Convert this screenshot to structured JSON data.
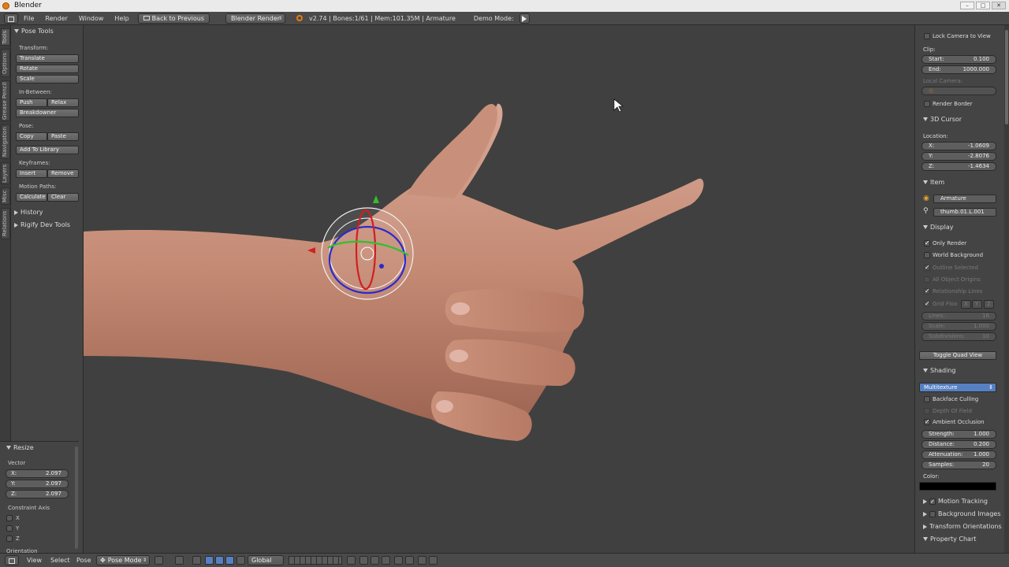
{
  "window": {
    "title": "Blender"
  },
  "menubar": {
    "items": [
      "File",
      "Render",
      "Window",
      "Help"
    ],
    "back_label": "Back to Previous",
    "engine": "Blender Render",
    "status": "v2.74 | Bones:1/61 | Mem:101.35M | Armature",
    "mode_label": "Demo Mode:"
  },
  "tabs": [
    "Tools",
    "Options",
    "Grease Pencil",
    "Navigation",
    "Layers",
    "Misc",
    "Relations"
  ],
  "tool_panel": {
    "title": "Pose Tools",
    "transform_label": "Transform:",
    "translate": "Translate",
    "rotate": "Rotate",
    "scale": "Scale",
    "inbetween_label": "In-Between:",
    "push": "Push",
    "relax": "Relax",
    "breakdowner": "Breakdowner",
    "pose_label": "Pose:",
    "copy": "Copy",
    "paste": "Paste",
    "add_library": "Add To Library",
    "keyframes_label": "Keyframes:",
    "insert": "Insert",
    "remove": "Remove",
    "motion_label": "Motion Paths:",
    "calculate": "Calculate",
    "clear": "Clear",
    "history": "History",
    "rigify": "Rigify Dev Tools"
  },
  "operator": {
    "title": "Resize",
    "vector_label": "Vector",
    "x_label": "X:",
    "x_val": "2.097",
    "y_label": "Y:",
    "y_val": "2.097",
    "z_label": "Z:",
    "z_val": "2.097",
    "constraint_label": "Constraint Axis",
    "cx": "X",
    "cy": "Y",
    "cz": "Z",
    "orientation_label": "Orientation"
  },
  "props": {
    "lock_camera": "Lock Camera to View",
    "clip_label": "Clip:",
    "start_label": "Start:",
    "start_val": "0.100",
    "end_label": "End:",
    "end_val": "1000.000",
    "local_camera": "Local Camera:",
    "render_border": "Render Border",
    "cursor_title": "3D Cursor",
    "location_label": "Location:",
    "cx_label": "X:",
    "cx_val": "-1.0609",
    "cy_label": "Y:",
    "cy_val": "-2.8076",
    "cz_label": "Z:",
    "cz_val": "-1.4634",
    "item_title": "Item",
    "item_object": "Armature",
    "item_bone": "thumb.01.L.001",
    "display_title": "Display",
    "only_render": "Only Render",
    "world_bg": "World Background",
    "outline_sel": "Outline Selected",
    "all_origins": "All Object Origins",
    "rel_lines": "Relationship Lines",
    "grid_floor": "Grid Floo",
    "gx": "X",
    "gy": "Y",
    "gz": "Z",
    "lines_label": "Lines:",
    "lines_val": "16",
    "scale_label": "Scale:",
    "scale_val": "1.000",
    "subdiv_label": "Subdivisions:",
    "subdiv_val": "10",
    "quad_view": "Toggle Quad View",
    "shading_title": "Shading",
    "shading_mode": "Multitexture",
    "backface": "Backface Culling",
    "dof": "Depth Of Field",
    "ao": "Ambient Occlusion",
    "strength_label": "Strength:",
    "strength_val": "1.000",
    "distance_label": "Distance:",
    "distance_val": "0.200",
    "atten_label": "Attenuation:",
    "atten_val": "1.000",
    "samples_label": "Samples:",
    "samples_val": "20",
    "color_label": "Color:",
    "motion_tracking": "Motion Tracking",
    "bg_images": "Background Images",
    "transform_orient": "Transform Orientations",
    "property_chart": "Property Chart"
  },
  "bottombar": {
    "view": "View",
    "select": "Select",
    "pose": "Pose",
    "mode": "Pose Mode",
    "orientation": "Global"
  },
  "colors": {
    "accent": "#5680c2",
    "viewport_bg": "#404040",
    "skin": "#c48a74"
  }
}
